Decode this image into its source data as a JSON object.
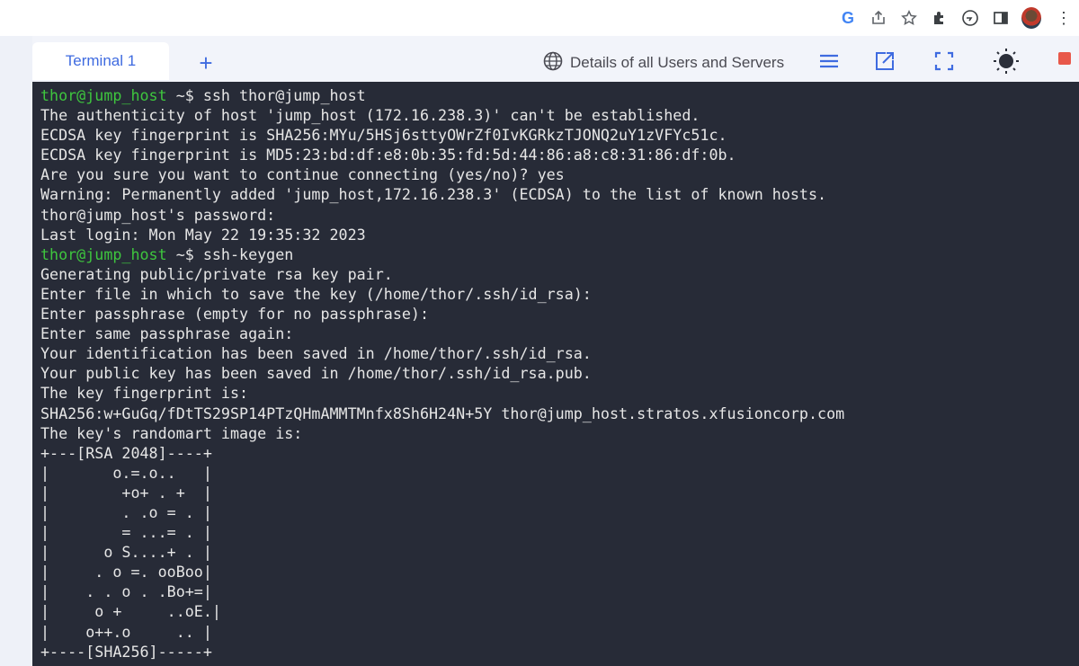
{
  "browser": {
    "icons": [
      "google-icon",
      "share-icon",
      "star-icon",
      "extensions-icon",
      "spiral-icon",
      "sidepanel-icon",
      "avatar",
      "kebab-menu-icon"
    ],
    "google_letter": "G"
  },
  "header": {
    "tab_label": "Terminal 1",
    "add_tab": "+",
    "details_link": "Details of all Users and Servers",
    "accent": "#3f6be0"
  },
  "terminal": {
    "background": "#272b37",
    "prompt_color": "#3ec63e",
    "lines": [
      {
        "prompt": "thor@jump_host",
        "cwd": " ~$",
        "text": " ssh thor@jump_host"
      },
      {
        "text": "The authenticity of host 'jump_host (172.16.238.3)' can't be established."
      },
      {
        "text": "ECDSA key fingerprint is SHA256:MYu/5HSj6sttyOWrZf0IvKGRkzTJONQ2uY1zVFYc51c."
      },
      {
        "text": "ECDSA key fingerprint is MD5:23:bd:df:e8:0b:35:fd:5d:44:86:a8:c8:31:86:df:0b."
      },
      {
        "text": "Are you sure you want to continue connecting (yes/no)? yes"
      },
      {
        "text": "Warning: Permanently added 'jump_host,172.16.238.3' (ECDSA) to the list of known hosts."
      },
      {
        "text": "thor@jump_host's password:"
      },
      {
        "text": "Last login: Mon May 22 19:35:32 2023"
      },
      {
        "prompt": "thor@jump_host",
        "cwd": " ~$",
        "text": " ssh-keygen"
      },
      {
        "text": "Generating public/private rsa key pair."
      },
      {
        "text": "Enter file in which to save the key (/home/thor/.ssh/id_rsa):"
      },
      {
        "text": "Enter passphrase (empty for no passphrase):"
      },
      {
        "text": "Enter same passphrase again:"
      },
      {
        "text": "Your identification has been saved in /home/thor/.ssh/id_rsa."
      },
      {
        "text": "Your public key has been saved in /home/thor/.ssh/id_rsa.pub."
      },
      {
        "text": "The key fingerprint is:"
      },
      {
        "text": "SHA256:w+GuGq/fDtTS29SP14PTzQHmAMMTMnfx8Sh6H24N+5Y thor@jump_host.stratos.xfusioncorp.com"
      },
      {
        "text": "The key's randomart image is:"
      },
      {
        "text": "+---[RSA 2048]----+"
      },
      {
        "text": "|       o.=.o..   |"
      },
      {
        "text": "|        +o+ . +  |"
      },
      {
        "text": "|        . .o = . |"
      },
      {
        "text": "|        = ...= . |"
      },
      {
        "text": "|      o S....+ . |"
      },
      {
        "text": "|     . o =. ooBoo|"
      },
      {
        "text": "|    . . o . .Bo+=|"
      },
      {
        "text": "|     o +     ..oE.|"
      },
      {
        "text": "|    o++.o     .. |"
      },
      {
        "text": "+----[SHA256]-----+"
      }
    ]
  }
}
